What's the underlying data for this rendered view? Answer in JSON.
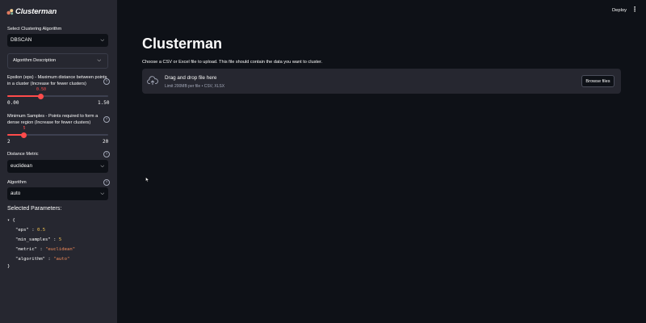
{
  "app": {
    "name": "Clusterman",
    "logo_icon": "bubbles-icon"
  },
  "header": {
    "deploy_label": "Deploy",
    "menu_icon": "⋮"
  },
  "sidebar": {
    "algorithm_select": {
      "label": "Select Clustering Algorithm",
      "value": "DBSCAN"
    },
    "description_expander": {
      "label": "Algorithm Description"
    },
    "eps_slider": {
      "label_line1": "Epsilon (eps) - Maximum distance between points",
      "label_line2": "in a cluster (Increase for fewer clusters)",
      "value_label": "0.50",
      "value": 0.5,
      "min_label": "0.00",
      "max_label": "1.50",
      "min": 0,
      "max": 1.5
    },
    "min_samples_slider": {
      "label_line1": "Minimum Samples - Points required to form a",
      "label_line2": "dense region (Increase for fewer clusters)",
      "value_label": "5",
      "value": 5,
      "min_label": "2",
      "max_label": "20",
      "min": 2,
      "max": 20
    },
    "metric_select": {
      "label": "Distance Metric",
      "value": "euclidean"
    },
    "algo_select": {
      "label": "Algorithm",
      "value": "auto"
    },
    "params": {
      "title": "Selected Parameters:",
      "open_brace": "{",
      "close_brace": "}",
      "entries": [
        {
          "key": "\"eps\"",
          "value": "0.5"
        },
        {
          "key": "\"min_samples\"",
          "value": "5"
        },
        {
          "key": "\"metric\"",
          "value": "\"euclidean\""
        },
        {
          "key": "\"algorithm\"",
          "value": "\"auto\""
        }
      ]
    }
  },
  "main": {
    "title": "Clusterman",
    "upload_caption": "Choose a CSV or Excel file to upload. This file should contain the data you want to cluster.",
    "dropzone_title": "Drag and drop file here",
    "dropzone_subtitle": "Limit 200MB per file • CSV, XLSX",
    "browse_label": "Browse files"
  },
  "colors": {
    "accent": "#ff4b4b",
    "sidebar_bg": "#262730",
    "main_bg": "#0e1117"
  }
}
